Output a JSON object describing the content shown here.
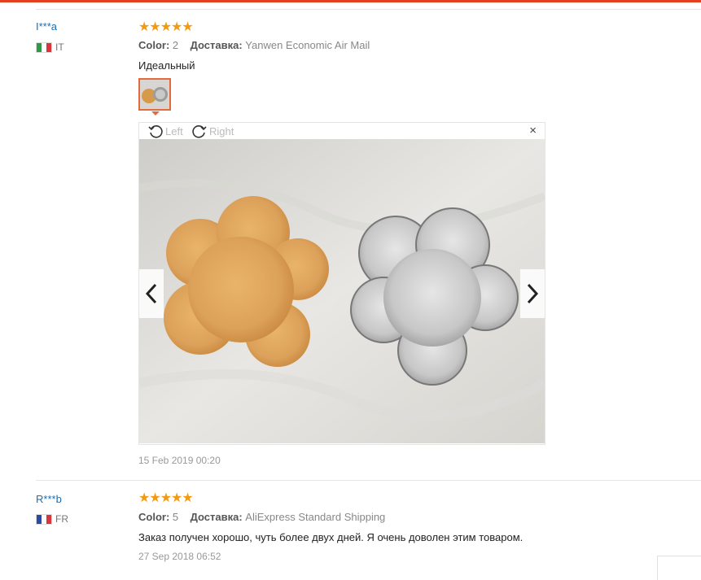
{
  "reviews": [
    {
      "user": "I***a",
      "country": "IT",
      "stars": "★★★★★",
      "color_label": "Color:",
      "color_value": "2",
      "shipping_label": "Доставка:",
      "shipping_value": "Yanwen Economic Air Mail",
      "text": "Идеальный",
      "date": "15 Feb 2019 00:20"
    },
    {
      "user": "R***b",
      "country": "FR",
      "stars": "★★★★★",
      "color_label": "Color:",
      "color_value": "5",
      "shipping_label": "Доставка:",
      "shipping_value": "AliExpress Standard Shipping",
      "text": "Заказ получен хорошо, чуть более двух дней. Я очень доволен этим товаром.",
      "date": "27 Sep 2018 06:52"
    }
  ],
  "viewer": {
    "rotate_left": "Left",
    "rotate_right": "Right",
    "close": "×"
  },
  "colors": {
    "accent": "#e3401f",
    "username": "#1a6fb5",
    "star": "#f29b12"
  },
  "icons": [
    "rotate-left-icon",
    "rotate-right-icon",
    "close-icon",
    "chevron-left-icon",
    "chevron-right-icon"
  ]
}
